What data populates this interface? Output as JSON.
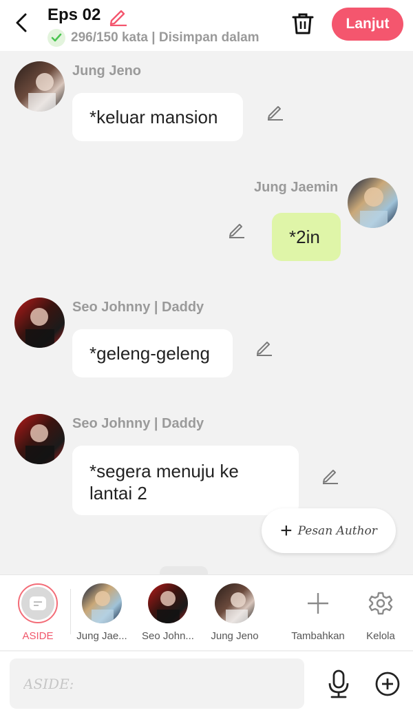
{
  "header": {
    "title": "Eps 02",
    "status": "296/150 kata | Disimpan dalam",
    "next_label": "Lanjut"
  },
  "messages": [
    {
      "speaker": "Jung Jeno",
      "text": "*keluar mansion",
      "side": "left"
    },
    {
      "speaker": "Jung Jaemin",
      "text": "*2in",
      "side": "right"
    },
    {
      "speaker": "Seo Johnny | Daddy",
      "text": "*geleng-geleng",
      "side": "left"
    },
    {
      "speaker": "Seo Johnny | Daddy",
      "text": "*segera menuju ke lantai 2",
      "side": "left"
    }
  ],
  "author_button": {
    "label": "Pesan Author"
  },
  "characters": {
    "aside_label": "ASIDE",
    "items": [
      {
        "label": "Jung Jae..."
      },
      {
        "label": "Seo John..."
      },
      {
        "label": "Jung Jeno"
      }
    ],
    "add_label": "Tambahkan",
    "manage_label": "Kelola"
  },
  "composer": {
    "placeholder": "ASIDE:"
  },
  "colors": {
    "accent": "#f4566e",
    "right_bubble": "#dff5a8",
    "check": "#4cc552"
  },
  "icons": [
    "back-arrow-icon",
    "pencil-icon",
    "check-icon",
    "trash-icon",
    "plus-icon",
    "gear-icon",
    "microphone-icon",
    "add-circle-icon",
    "chat-bubble-icon"
  ]
}
